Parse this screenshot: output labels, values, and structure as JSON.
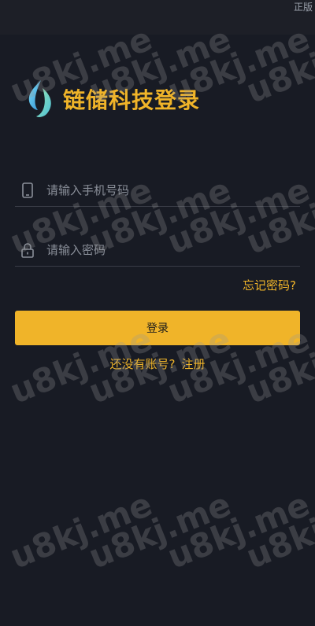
{
  "corner_tag": "正版",
  "brand": {
    "title": "链储科技登录",
    "logo_icon": "drop-leaf-logo"
  },
  "form": {
    "phone_placeholder": "请输入手机号码",
    "phone_value": "",
    "password_placeholder": "请输入密码",
    "password_value": ""
  },
  "forgot_link": "忘记密码?",
  "login_button": "登录",
  "register": {
    "prompt": "还没有账号?",
    "link": "注册"
  },
  "watermark_text": "u8kj.me",
  "colors": {
    "background": "#181b24",
    "accent": "#f0b429",
    "divider": "#3a3d47"
  }
}
